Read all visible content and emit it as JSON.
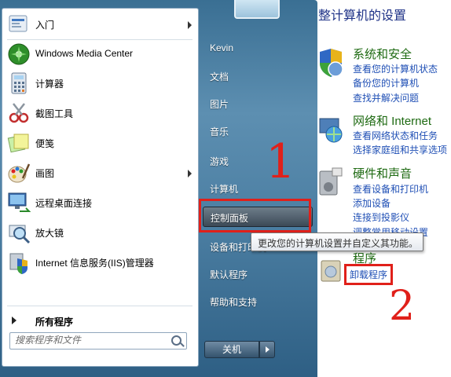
{
  "control_panel": {
    "title": "整计算机的设置",
    "sections": [
      {
        "heading": "系统和安全",
        "links": [
          "查看您的计算机状态",
          "备份您的计算机",
          "查找并解决问题"
        ]
      },
      {
        "heading": "网络和 Internet",
        "links": [
          "查看网络状态和任务",
          "选择家庭组和共享选项"
        ]
      },
      {
        "heading": "硬件和声音",
        "links": [
          "查看设备和打印机",
          "添加设备",
          "连接到投影仪",
          "调整常用移动设置"
        ]
      },
      {
        "heading": "程序",
        "links": [
          "卸载程序"
        ]
      }
    ]
  },
  "start_menu": {
    "programs": [
      {
        "label": "入门",
        "icon": "getting-started-icon",
        "submenu": true
      },
      {
        "label": "Windows Media Center",
        "icon": "media-center-icon",
        "submenu": false
      },
      {
        "label": "计算器",
        "icon": "calculator-icon",
        "submenu": false
      },
      {
        "label": "截图工具",
        "icon": "snipping-tool-icon",
        "submenu": false
      },
      {
        "label": "便笺",
        "icon": "sticky-notes-icon",
        "submenu": false
      },
      {
        "label": "画图",
        "icon": "paint-icon",
        "submenu": true
      },
      {
        "label": "远程桌面连接",
        "icon": "remote-desktop-icon",
        "submenu": false
      },
      {
        "label": "放大镜",
        "icon": "magnifier-icon",
        "submenu": false
      },
      {
        "label": "Internet 信息服务(IIS)管理器",
        "icon": "iis-manager-icon",
        "submenu": false
      }
    ],
    "all_programs": "所有程序",
    "search_placeholder": "搜索程序和文件",
    "right_items": [
      "Kevin",
      "文档",
      "图片",
      "音乐",
      "游戏",
      "计算机",
      "控制面板",
      "设备和打印机",
      "默认程序",
      "帮助和支持"
    ],
    "tooltip": "更改您的计算机设置并自定义其功能。",
    "shutdown_label": "关机"
  },
  "annotations": [
    "1",
    "2"
  ]
}
